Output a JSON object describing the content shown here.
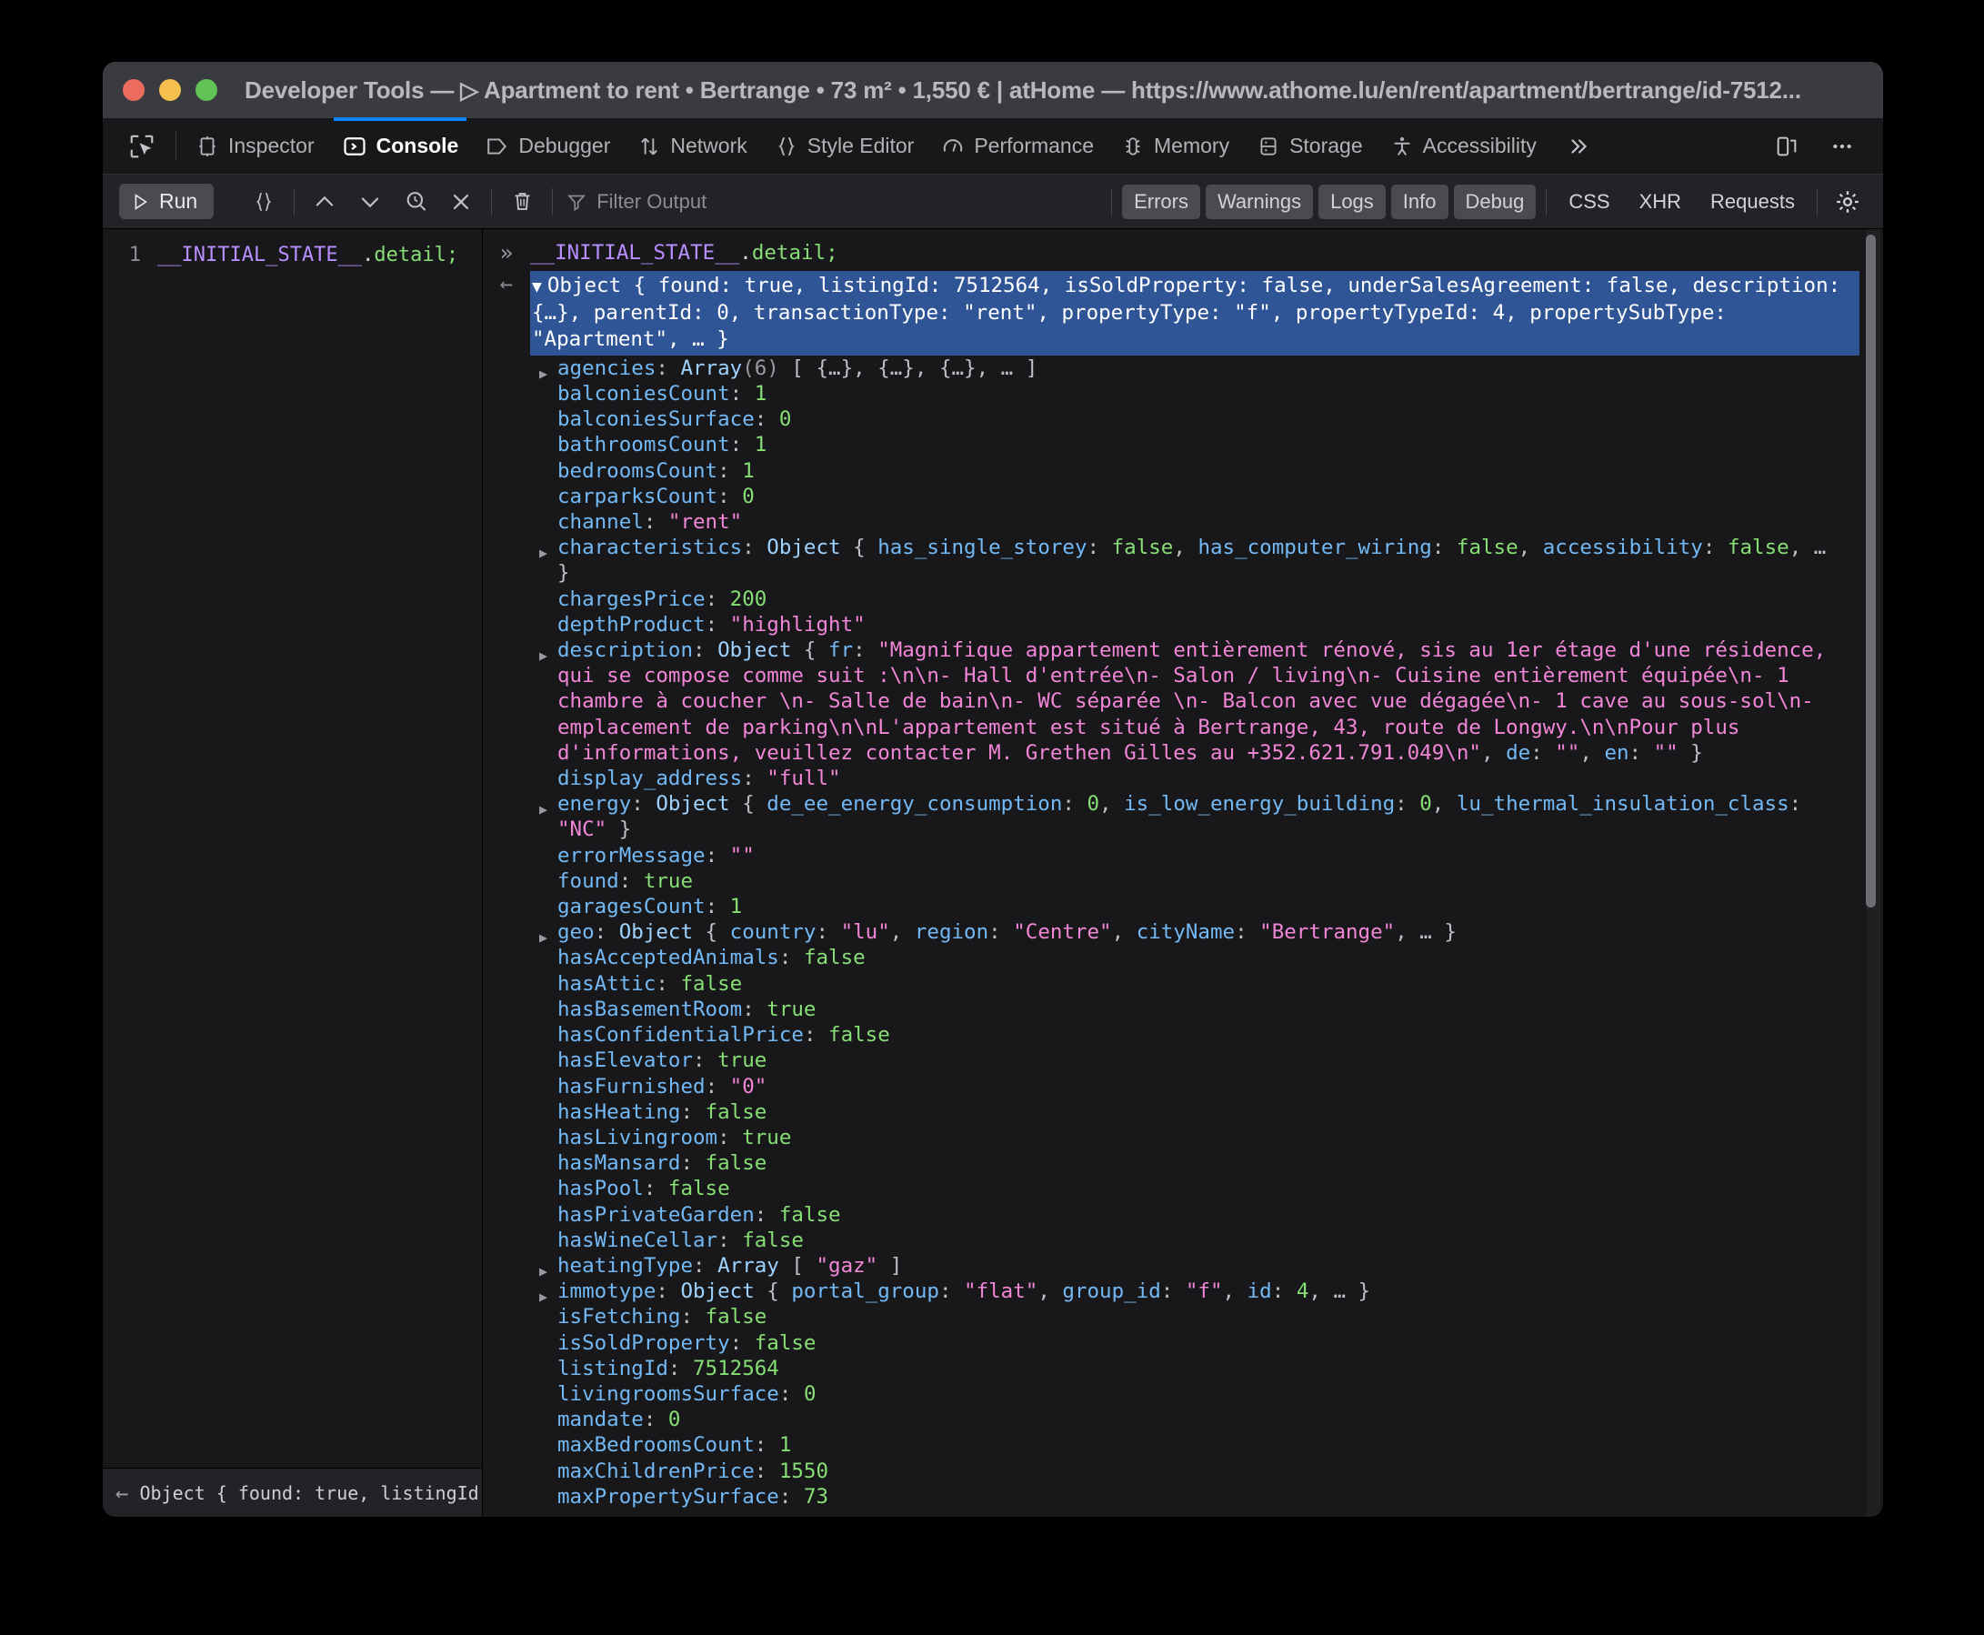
{
  "window": {
    "title": "Developer Tools — ▷ Apartment to rent • Bertrange • 73 m² • 1,550 € | atHome — https://www.athome.lu/en/rent/apartment/bertrange/id-7512..."
  },
  "tabs": [
    {
      "label": "Inspector",
      "icon": "inspector-icon",
      "selected": false
    },
    {
      "label": "Console",
      "icon": "console-icon",
      "selected": true
    },
    {
      "label": "Debugger",
      "icon": "debugger-icon",
      "selected": false
    },
    {
      "label": "Network",
      "icon": "network-icon",
      "selected": false
    },
    {
      "label": "Style Editor",
      "icon": "style-editor-icon",
      "selected": false
    },
    {
      "label": "Performance",
      "icon": "performance-icon",
      "selected": false
    },
    {
      "label": "Memory",
      "icon": "memory-icon",
      "selected": false
    },
    {
      "label": "Storage",
      "icon": "storage-icon",
      "selected": false
    },
    {
      "label": "Accessibility",
      "icon": "accessibility-icon",
      "selected": false
    }
  ],
  "filterbar": {
    "run_label": "Run",
    "filter_placeholder": "Filter Output",
    "levels": [
      {
        "label": "Errors",
        "active": true
      },
      {
        "label": "Warnings",
        "active": true
      },
      {
        "label": "Logs",
        "active": true
      },
      {
        "label": "Info",
        "active": true
      },
      {
        "label": "Debug",
        "active": true
      }
    ],
    "categories": [
      {
        "label": "CSS",
        "active": false
      },
      {
        "label": "XHR",
        "active": false
      },
      {
        "label": "Requests",
        "active": false
      }
    ]
  },
  "editor": {
    "line_number": "1",
    "code_var": "__INITIAL_STATE__",
    "code_dot": ".",
    "code_prop": "detail",
    "code_semi": ";",
    "status_text": "Object { found: true, listingId:…"
  },
  "console": {
    "input_var": "__INITIAL_STATE__",
    "input_dot": ".",
    "input_prop": "detail",
    "input_semi": ";",
    "result_summary": "Object { found: true, listingId: 7512564, isSoldProperty: false, underSalesAgreement: false, description: {…}, parentId: 0, transactionType: \"rent\", propertyType: \"f\", propertyTypeId: 4, propertySubType: \"Apartment\", … }",
    "properties": [
      {
        "twisty": true,
        "key": "agencies",
        "segments": [
          {
            "t": "kd",
            "v": ": "
          },
          {
            "t": "typ",
            "v": "Array"
          },
          {
            "t": "cnt",
            "v": "(6)"
          },
          {
            "t": "kd",
            "v": " [ "
          },
          {
            "t": "ell",
            "v": "{…}, {…}, {…}, …"
          },
          {
            "t": "kd",
            "v": " ]"
          }
        ]
      },
      {
        "twisty": false,
        "key": "balconiesCount",
        "segments": [
          {
            "t": "kd",
            "v": ": "
          },
          {
            "t": "num",
            "v": "1"
          }
        ]
      },
      {
        "twisty": false,
        "key": "balconiesSurface",
        "segments": [
          {
            "t": "kd",
            "v": ": "
          },
          {
            "t": "num",
            "v": "0"
          }
        ]
      },
      {
        "twisty": false,
        "key": "bathroomsCount",
        "segments": [
          {
            "t": "kd",
            "v": ": "
          },
          {
            "t": "num",
            "v": "1"
          }
        ]
      },
      {
        "twisty": false,
        "key": "bedroomsCount",
        "segments": [
          {
            "t": "kd",
            "v": ": "
          },
          {
            "t": "num",
            "v": "1"
          }
        ]
      },
      {
        "twisty": false,
        "key": "carparksCount",
        "segments": [
          {
            "t": "kd",
            "v": ": "
          },
          {
            "t": "num",
            "v": "0"
          }
        ]
      },
      {
        "twisty": false,
        "key": "channel",
        "segments": [
          {
            "t": "kd",
            "v": ": "
          },
          {
            "t": "str",
            "v": "\"rent\""
          }
        ]
      },
      {
        "twisty": true,
        "key": "characteristics",
        "segments": [
          {
            "t": "kd",
            "v": ": "
          },
          {
            "t": "typ",
            "v": "Object"
          },
          {
            "t": "kd",
            "v": " { "
          },
          {
            "t": "k",
            "v": "has_single_storey"
          },
          {
            "t": "kd",
            "v": ": "
          },
          {
            "t": "num",
            "v": "false"
          },
          {
            "t": "kd",
            "v": ", "
          },
          {
            "t": "k",
            "v": "has_computer_wiring"
          },
          {
            "t": "kd",
            "v": ": "
          },
          {
            "t": "num",
            "v": "false"
          },
          {
            "t": "kd",
            "v": ", "
          },
          {
            "t": "k",
            "v": "accessibility"
          },
          {
            "t": "kd",
            "v": ": "
          },
          {
            "t": "num",
            "v": "false"
          },
          {
            "t": "kd",
            "v": ", "
          },
          {
            "t": "ell",
            "v": "…"
          },
          {
            "t": "kd",
            "v": " }"
          }
        ]
      },
      {
        "twisty": false,
        "key": "chargesPrice",
        "segments": [
          {
            "t": "kd",
            "v": ": "
          },
          {
            "t": "num",
            "v": "200"
          }
        ]
      },
      {
        "twisty": false,
        "key": "depthProduct",
        "segments": [
          {
            "t": "kd",
            "v": ": "
          },
          {
            "t": "str",
            "v": "\"highlight\""
          }
        ]
      },
      {
        "twisty": true,
        "key": "description",
        "segments": [
          {
            "t": "kd",
            "v": ": "
          },
          {
            "t": "typ",
            "v": "Object"
          },
          {
            "t": "kd",
            "v": " { "
          },
          {
            "t": "k",
            "v": "fr"
          },
          {
            "t": "kd",
            "v": ": "
          },
          {
            "t": "str",
            "v": "\"Magnifique appartement entièrement rénové, sis au 1er étage d'une résidence, qui se compose comme suit :\\n\\n- Hall d'entrée\\n- Salon / living\\n- Cuisine entièrement équipée\\n- 1 chambre à coucher \\n- Salle de bain\\n- WC séparée \\n- Balcon avec vue dégagée\\n- 1 cave au sous-sol\\n- emplacement de parking\\n\\nL'appartement est situé à Bertrange, 43, route de Longwy.\\n\\nPour plus d'informations, veuillez contacter M. Grethen Gilles au +352.621.791.049\\n\""
          },
          {
            "t": "kd",
            "v": ", "
          },
          {
            "t": "k",
            "v": "de"
          },
          {
            "t": "kd",
            "v": ": "
          },
          {
            "t": "str",
            "v": "\"\""
          },
          {
            "t": "kd",
            "v": ", "
          },
          {
            "t": "k",
            "v": "en"
          },
          {
            "t": "kd",
            "v": ": "
          },
          {
            "t": "str",
            "v": "\"\""
          },
          {
            "t": "kd",
            "v": " }"
          }
        ]
      },
      {
        "twisty": false,
        "key": "display_address",
        "segments": [
          {
            "t": "kd",
            "v": ": "
          },
          {
            "t": "str",
            "v": "\"full\""
          }
        ]
      },
      {
        "twisty": true,
        "key": "energy",
        "segments": [
          {
            "t": "kd",
            "v": ": "
          },
          {
            "t": "typ",
            "v": "Object"
          },
          {
            "t": "kd",
            "v": " { "
          },
          {
            "t": "k",
            "v": "de_ee_energy_consumption"
          },
          {
            "t": "kd",
            "v": ": "
          },
          {
            "t": "num",
            "v": "0"
          },
          {
            "t": "kd",
            "v": ", "
          },
          {
            "t": "k",
            "v": "is_low_energy_building"
          },
          {
            "t": "kd",
            "v": ": "
          },
          {
            "t": "num",
            "v": "0"
          },
          {
            "t": "kd",
            "v": ", "
          },
          {
            "t": "k",
            "v": "lu_thermal_insulation_class"
          },
          {
            "t": "kd",
            "v": ": "
          },
          {
            "t": "str",
            "v": "\"NC\""
          },
          {
            "t": "kd",
            "v": " }"
          }
        ]
      },
      {
        "twisty": false,
        "key": "errorMessage",
        "segments": [
          {
            "t": "kd",
            "v": ": "
          },
          {
            "t": "str",
            "v": "\"\""
          }
        ]
      },
      {
        "twisty": false,
        "key": "found",
        "segments": [
          {
            "t": "kd",
            "v": ": "
          },
          {
            "t": "num",
            "v": "true"
          }
        ]
      },
      {
        "twisty": false,
        "key": "garagesCount",
        "segments": [
          {
            "t": "kd",
            "v": ": "
          },
          {
            "t": "num",
            "v": "1"
          }
        ]
      },
      {
        "twisty": true,
        "key": "geo",
        "segments": [
          {
            "t": "kd",
            "v": ": "
          },
          {
            "t": "typ",
            "v": "Object"
          },
          {
            "t": "kd",
            "v": " { "
          },
          {
            "t": "k",
            "v": "country"
          },
          {
            "t": "kd",
            "v": ": "
          },
          {
            "t": "str",
            "v": "\"lu\""
          },
          {
            "t": "kd",
            "v": ", "
          },
          {
            "t": "k",
            "v": "region"
          },
          {
            "t": "kd",
            "v": ": "
          },
          {
            "t": "str",
            "v": "\"Centre\""
          },
          {
            "t": "kd",
            "v": ", "
          },
          {
            "t": "k",
            "v": "cityName"
          },
          {
            "t": "kd",
            "v": ": "
          },
          {
            "t": "str",
            "v": "\"Bertrange\""
          },
          {
            "t": "kd",
            "v": ", "
          },
          {
            "t": "ell",
            "v": "…"
          },
          {
            "t": "kd",
            "v": " }"
          }
        ]
      },
      {
        "twisty": false,
        "key": "hasAcceptedAnimals",
        "segments": [
          {
            "t": "kd",
            "v": ": "
          },
          {
            "t": "num",
            "v": "false"
          }
        ]
      },
      {
        "twisty": false,
        "key": "hasAttic",
        "segments": [
          {
            "t": "kd",
            "v": ": "
          },
          {
            "t": "num",
            "v": "false"
          }
        ]
      },
      {
        "twisty": false,
        "key": "hasBasementRoom",
        "segments": [
          {
            "t": "kd",
            "v": ": "
          },
          {
            "t": "num",
            "v": "true"
          }
        ]
      },
      {
        "twisty": false,
        "key": "hasConfidentialPrice",
        "segments": [
          {
            "t": "kd",
            "v": ": "
          },
          {
            "t": "num",
            "v": "false"
          }
        ]
      },
      {
        "twisty": false,
        "key": "hasElevator",
        "segments": [
          {
            "t": "kd",
            "v": ": "
          },
          {
            "t": "num",
            "v": "true"
          }
        ]
      },
      {
        "twisty": false,
        "key": "hasFurnished",
        "segments": [
          {
            "t": "kd",
            "v": ": "
          },
          {
            "t": "str",
            "v": "\"0\""
          }
        ]
      },
      {
        "twisty": false,
        "key": "hasHeating",
        "segments": [
          {
            "t": "kd",
            "v": ": "
          },
          {
            "t": "num",
            "v": "false"
          }
        ]
      },
      {
        "twisty": false,
        "key": "hasLivingroom",
        "segments": [
          {
            "t": "kd",
            "v": ": "
          },
          {
            "t": "num",
            "v": "true"
          }
        ]
      },
      {
        "twisty": false,
        "key": "hasMansard",
        "segments": [
          {
            "t": "kd",
            "v": ": "
          },
          {
            "t": "num",
            "v": "false"
          }
        ]
      },
      {
        "twisty": false,
        "key": "hasPool",
        "segments": [
          {
            "t": "kd",
            "v": ": "
          },
          {
            "t": "num",
            "v": "false"
          }
        ]
      },
      {
        "twisty": false,
        "key": "hasPrivateGarden",
        "segments": [
          {
            "t": "kd",
            "v": ": "
          },
          {
            "t": "num",
            "v": "false"
          }
        ]
      },
      {
        "twisty": false,
        "key": "hasWineCellar",
        "segments": [
          {
            "t": "kd",
            "v": ": "
          },
          {
            "t": "num",
            "v": "false"
          }
        ]
      },
      {
        "twisty": true,
        "key": "heatingType",
        "segments": [
          {
            "t": "kd",
            "v": ": "
          },
          {
            "t": "typ",
            "v": "Array"
          },
          {
            "t": "kd",
            "v": " [ "
          },
          {
            "t": "str",
            "v": "\"gaz\""
          },
          {
            "t": "kd",
            "v": " ]"
          }
        ]
      },
      {
        "twisty": true,
        "key": "immotype",
        "segments": [
          {
            "t": "kd",
            "v": ": "
          },
          {
            "t": "typ",
            "v": "Object"
          },
          {
            "t": "kd",
            "v": " { "
          },
          {
            "t": "k",
            "v": "portal_group"
          },
          {
            "t": "kd",
            "v": ": "
          },
          {
            "t": "str",
            "v": "\"flat\""
          },
          {
            "t": "kd",
            "v": ", "
          },
          {
            "t": "k",
            "v": "group_id"
          },
          {
            "t": "kd",
            "v": ": "
          },
          {
            "t": "str",
            "v": "\"f\""
          },
          {
            "t": "kd",
            "v": ", "
          },
          {
            "t": "k",
            "v": "id"
          },
          {
            "t": "kd",
            "v": ": "
          },
          {
            "t": "num",
            "v": "4"
          },
          {
            "t": "kd",
            "v": ", "
          },
          {
            "t": "ell",
            "v": "…"
          },
          {
            "t": "kd",
            "v": " }"
          }
        ]
      },
      {
        "twisty": false,
        "key": "isFetching",
        "segments": [
          {
            "t": "kd",
            "v": ": "
          },
          {
            "t": "num",
            "v": "false"
          }
        ]
      },
      {
        "twisty": false,
        "key": "isSoldProperty",
        "segments": [
          {
            "t": "kd",
            "v": ": "
          },
          {
            "t": "num",
            "v": "false"
          }
        ]
      },
      {
        "twisty": false,
        "key": "listingId",
        "segments": [
          {
            "t": "kd",
            "v": ": "
          },
          {
            "t": "num",
            "v": "7512564"
          }
        ]
      },
      {
        "twisty": false,
        "key": "livingroomsSurface",
        "segments": [
          {
            "t": "kd",
            "v": ": "
          },
          {
            "t": "num",
            "v": "0"
          }
        ]
      },
      {
        "twisty": false,
        "key": "mandate",
        "segments": [
          {
            "t": "kd",
            "v": ": "
          },
          {
            "t": "num",
            "v": "0"
          }
        ]
      },
      {
        "twisty": false,
        "key": "maxBedroomsCount",
        "segments": [
          {
            "t": "kd",
            "v": ": "
          },
          {
            "t": "num",
            "v": "1"
          }
        ]
      },
      {
        "twisty": false,
        "key": "maxChildrenPrice",
        "segments": [
          {
            "t": "kd",
            "v": ": "
          },
          {
            "t": "num",
            "v": "1550"
          }
        ]
      },
      {
        "twisty": false,
        "key": "maxPropertySurface",
        "segments": [
          {
            "t": "kd",
            "v": ": "
          },
          {
            "t": "num",
            "v": "73"
          }
        ]
      }
    ]
  },
  "colors": {
    "accent": "#0a84ff",
    "selection": "#2f5597",
    "key": "#73b9f5",
    "number": "#86de74",
    "string": "#f286d6",
    "titlebar": "#3a3a41"
  }
}
